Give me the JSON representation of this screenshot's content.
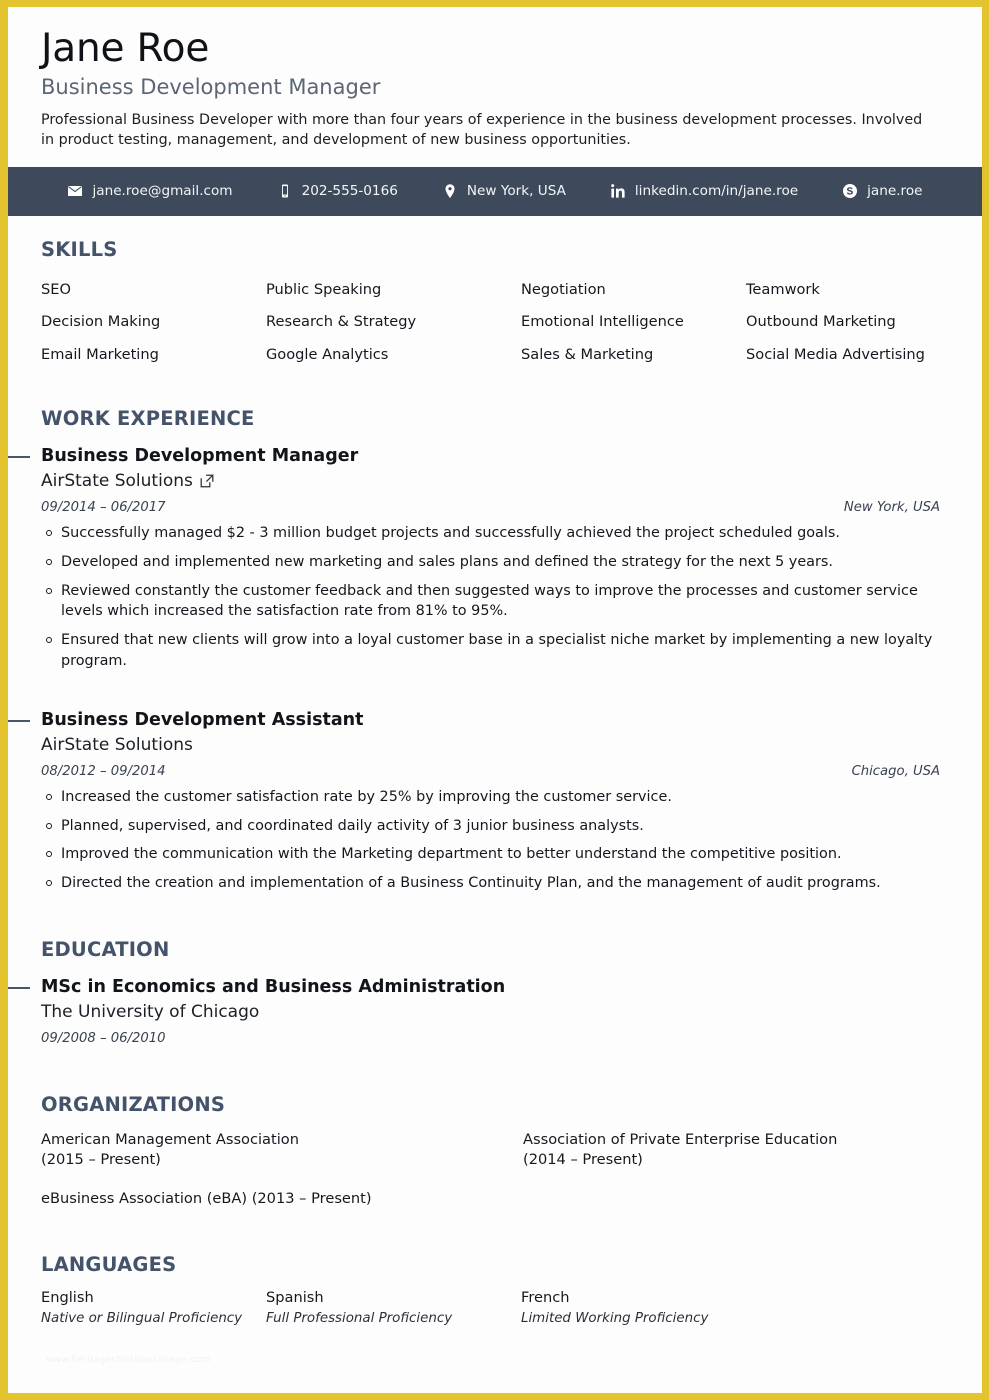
{
  "theme": {
    "accent_border": "#e3c32e",
    "contact_bar_bg": "#3e4a5c",
    "section_heading": "#45536a",
    "subtitle": "#5b6675"
  },
  "header": {
    "name": "Jane Roe",
    "job_title": "Business Development Manager",
    "summary": "Professional Business Developer with more than four years of experience in the business development processes. Involved in product testing, management, and development of new business opportunities."
  },
  "contact": [
    {
      "icon": "envelope-icon",
      "value": "jane.roe@gmail.com"
    },
    {
      "icon": "mobile-phone-icon",
      "value": "202-555-0166"
    },
    {
      "icon": "map-pin-icon",
      "value": "New York, USA"
    },
    {
      "icon": "linkedin-icon",
      "value": "linkedin.com/in/jane.roe"
    },
    {
      "icon": "skype-icon",
      "value": "jane.roe"
    }
  ],
  "skills": {
    "heading": "SKILLS",
    "items": [
      "SEO",
      "Public Speaking",
      "Negotiation",
      "Teamwork",
      "Decision Making",
      "Research & Strategy",
      "Emotional Intelligence",
      "Outbound Marketing",
      "Email Marketing",
      "Google Analytics",
      "Sales & Marketing",
      "Social Media Advertising"
    ]
  },
  "work": {
    "heading": "WORK EXPERIENCE",
    "entries": [
      {
        "role": "Business Development Manager",
        "company": "AirState Solutions",
        "has_link": true,
        "link_icon": "external-link-icon",
        "dates": "09/2014 – 06/2017",
        "location": "New York, USA",
        "bullets": [
          "Successfully managed $2 - 3 million budget projects and successfully achieved the project scheduled goals.",
          "Developed and implemented new marketing and sales plans and defined the strategy for the next 5 years.",
          "Reviewed constantly the customer feedback and then suggested ways to improve the processes and customer service levels which increased the satisfaction rate from 81% to 95%.",
          "Ensured that new clients will grow into a loyal customer base in a specialist niche market by implementing a new loyalty program."
        ]
      },
      {
        "role": "Business Development Assistant",
        "company": "AirState Solutions",
        "has_link": false,
        "link_icon": "",
        "dates": "08/2012 – 09/2014",
        "location": "Chicago, USA",
        "bullets": [
          "Increased the customer satisfaction rate by 25% by improving the customer service.",
          "Planned, supervised, and coordinated daily activity of 3 junior business analysts.",
          "Improved the communication with the Marketing department to better understand the competitive position.",
          "Directed the creation and implementation of a Business Continuity Plan, and the management of audit programs."
        ]
      }
    ]
  },
  "education": {
    "heading": "EDUCATION",
    "entries": [
      {
        "degree": "MSc in Economics and Business Administration",
        "school": "The University of Chicago",
        "dates": "09/2008 – 06/2010"
      }
    ]
  },
  "organizations": {
    "heading": "ORGANIZATIONS",
    "items": [
      "American Management Association\n(2015 – Present)",
      "Association of Private Enterprise Education\n(2014 – Present)",
      "eBusiness Association (eBA) (2013 – Present)"
    ]
  },
  "languages": {
    "heading": "LANGUAGES",
    "items": [
      {
        "name": "English",
        "level": "Native or Bilingual Proficiency"
      },
      {
        "name": "Spanish",
        "level": "Full Professional Proficiency"
      },
      {
        "name": "French",
        "level": "Limited Working Proficiency"
      }
    ]
  },
  "watermark": "www.heritagechristiancollege.com"
}
